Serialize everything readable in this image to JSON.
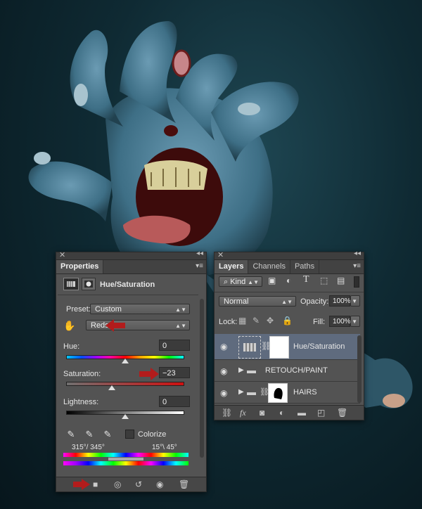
{
  "colors": {
    "accent_red": "#b21c1c",
    "panel_bg": "#535353",
    "selected_row": "#5f6b7e"
  },
  "properties": {
    "tab": "Properties",
    "adjustment_title": "Hue/Saturation",
    "preset_label": "Preset:",
    "preset_value": "Custom",
    "channel_value": "Reds",
    "hue_label": "Hue:",
    "hue_value": "0",
    "hue_level": 0,
    "saturation_label": "Saturation:",
    "saturation_value": "−23",
    "saturation_level": -23,
    "lightness_label": "Lightness:",
    "lightness_value": "0",
    "lightness_level": 0,
    "colorize_label": "Colorize",
    "colorize_checked": false,
    "range_left": "315°/ 345°",
    "range_right": "15°\\ 45°",
    "icons": [
      "adjustment-layer-icon",
      "mask-icon",
      "hand-targeted-icon",
      "eyedropper-icon",
      "eyedropper-plus-icon",
      "eyedropper-minus-icon",
      "clip-to-layer-icon",
      "view-previous-icon",
      "reset-icon",
      "visibility-icon",
      "trash-icon",
      "panel-menu-icon"
    ]
  },
  "layers": {
    "tabs": [
      "Layers",
      "Channels",
      "Paths"
    ],
    "filter_kind": "Kind",
    "blend_mode": "Normal",
    "opacity_label": "Opacity:",
    "opacity_value": "100%",
    "lock_label": "Lock:",
    "fill_label": "Fill:",
    "fill_value": "100%",
    "rows": [
      {
        "name": "Hue/Saturation",
        "type": "adjustment",
        "selected": true
      },
      {
        "name": "RETOUCH/PAINT",
        "type": "group",
        "selected": false
      },
      {
        "name": "HAIRS",
        "type": "layer",
        "selected": false
      }
    ],
    "footer_icons": [
      "link-icon",
      "fx-icon",
      "add-mask-icon",
      "adjustment-icon",
      "new-group-icon",
      "new-layer-icon",
      "trash-icon"
    ]
  }
}
